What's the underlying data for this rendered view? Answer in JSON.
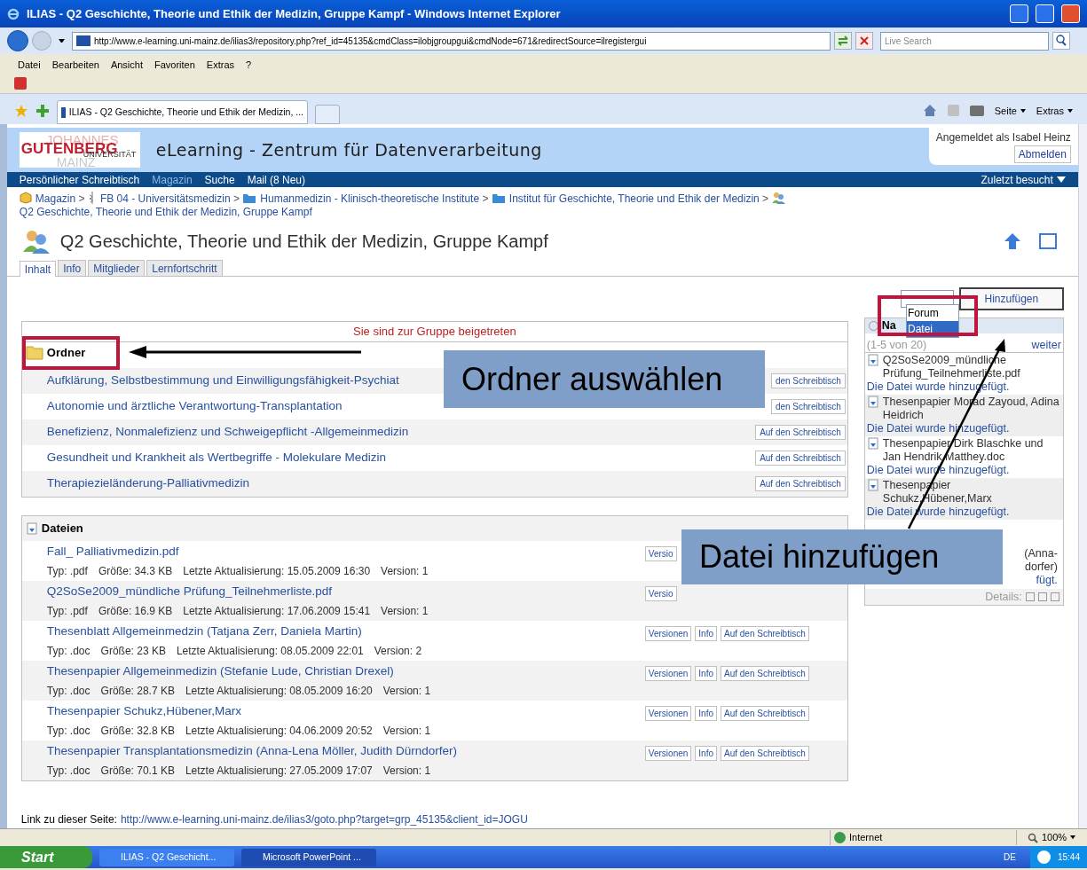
{
  "window": {
    "title": "ILIAS - Q2 Geschichte, Theorie und Ethik der Medizin, Gruppe Kampf - Windows Internet Explorer"
  },
  "address": {
    "url": "http://www.e-learning.uni-mainz.de/ilias3/repository.php?ref_id=45135&cmdClass=ilobjgroupgui&cmdNode=671&redirectSource=ilregistergui"
  },
  "search": {
    "placeholder": "Live Search"
  },
  "menu": [
    "Datei",
    "Bearbeiten",
    "Ansicht",
    "Favoriten",
    "Extras",
    "?"
  ],
  "browser_tab": {
    "title": "ILIAS - Q2 Geschichte, Theorie und Ethik der Medizin, ..."
  },
  "command_bar": [
    "Seite",
    "Extras"
  ],
  "site": {
    "logo": {
      "top": "JOHANNES",
      "main": "GUTENBERG",
      "sub": "UNIVERSITÄT",
      "bottom": "MAINZ"
    },
    "title": "eLearning - Zentrum für Datenverarbeitung",
    "login_text": "Angemeldet als Isabel Heinz",
    "logout": "Abmelden"
  },
  "nav": {
    "items": [
      {
        "label": "Persönlicher Schreibtisch",
        "selected": false
      },
      {
        "label": "Magazin",
        "selected": true
      },
      {
        "label": "Suche",
        "selected": false
      },
      {
        "label": "Mail (8 Neu)",
        "selected": false
      }
    ],
    "recent": "Zuletzt besucht"
  },
  "breadcrumb_separator": ">",
  "breadcrumb": [
    {
      "label": "Magazin",
      "kind": "box"
    },
    {
      "label": "FB 04 - Universitätsmedizin",
      "kind": "staff"
    },
    {
      "label": "Humanmedizin - Klinisch-theoretische Institute",
      "kind": "folder"
    },
    {
      "label": "Institut für Geschichte, Theorie und Ethik der Medizin",
      "kind": "folder"
    },
    {
      "label": "Q2 Geschichte, Theorie und Ethik der Medizin, Gruppe Kampf",
      "kind": "group"
    }
  ],
  "page_title": "Q2 Geschichte, Theorie und Ethik der Medizin, Gruppe Kampf",
  "tabs": [
    {
      "label": "Inhalt",
      "selected": true
    },
    {
      "label": "Info",
      "selected": false
    },
    {
      "label": "Mitglieder",
      "selected": false
    },
    {
      "label": "Lernfortschritt",
      "selected": false
    }
  ],
  "add_control": {
    "options": [
      {
        "label": "Forum",
        "selected": false
      },
      {
        "label": "Datei",
        "selected": true
      }
    ],
    "button": "Hinzufügen"
  },
  "message": "Sie sind zur Gruppe beigetreten",
  "folders": {
    "title": "Ordner",
    "rows": [
      {
        "name": "Aufklärung, Selbstbestimmung und Einwilligungsfähigkeit-Psychiat",
        "button": "den Schreibtisch"
      },
      {
        "name": "Autonomie und ärztliche Verantwortung-Transplantation",
        "button": "den Schreibtisch"
      },
      {
        "name": "Benefizienz, Nonmalefizienz und Schweigepflicht -Allgemeinmedizin",
        "button": "Auf den Schreibtisch"
      },
      {
        "name": "Gesundheit und Krankheit als Wertbegriffe - Molekulare Medizin",
        "button": "Auf den Schreibtisch"
      },
      {
        "name": "Therapiezieländerung-Palliativmedizin",
        "button": "Auf den Schreibtisch"
      }
    ]
  },
  "files": {
    "title": "Dateien",
    "rows": [
      {
        "name": "Fall_ Palliativmedizin.pdf",
        "meta": [
          "Typ: .pdf",
          "Größe: 34.3 KB",
          "Letzte Aktualisierung: 15.05.2009 16:30",
          "Version: 1"
        ],
        "buttons": [
          "Versio"
        ]
      },
      {
        "name": "Q2SoSe2009_mündliche Prüfung_Teilnehmerliste.pdf",
        "meta": [
          "Typ: .pdf",
          "Größe: 16.9 KB",
          "Letzte Aktualisierung: 17.06.2009 15:41",
          "Version: 1"
        ],
        "buttons": [
          "Versio"
        ]
      },
      {
        "name": "Thesenblatt Allgemeinmedzin (Tatjana Zerr, Daniela Martin)",
        "meta": [
          "Typ: .doc",
          "Größe: 23 KB",
          "Letzte Aktualisierung: 08.05.2009 22:01",
          "Version: 2"
        ],
        "buttons": [
          "Versionen",
          "Info",
          "Auf den Schreibtisch"
        ]
      },
      {
        "name": "Thesenpapier Allgemeinmedizin (Stefanie Lude, Christian Drexel)",
        "meta": [
          "Typ: .doc",
          "Größe: 28.7 KB",
          "Letzte Aktualisierung: 08.05.2009 16:20",
          "Version: 1"
        ],
        "buttons": [
          "Versionen",
          "Info",
          "Auf den Schreibtisch"
        ]
      },
      {
        "name": "Thesenpapier Schukz,Hübener,Marx",
        "meta": [
          "Typ: .doc",
          "Größe: 32.8 KB",
          "Letzte Aktualisierung: 04.06.2009 20:52",
          "Version: 1"
        ],
        "buttons": [
          "Versionen",
          "Info",
          "Auf den Schreibtisch"
        ]
      },
      {
        "name": "Thesenpapier Transplantationsmedizin (Anna-Lena Möller, Judith Dürndorfer)",
        "meta": [
          "Typ: .doc",
          "Größe: 70.1 KB",
          "Letzte Aktualisierung: 27.05.2009 17:07",
          "Version: 1"
        ],
        "buttons": [
          "Versionen",
          "Info",
          "Auf den Schreibtisch"
        ]
      }
    ]
  },
  "news": {
    "title": "Na",
    "range": "(1-5 von 20)",
    "more": "weiter",
    "items": [
      {
        "title": "Q2SoSe2009_mündliche Prüfung_Teilnehmerliste.pdf",
        "note": "Die Datei wurde hinzugefügt."
      },
      {
        "title": "Thesenpapier Morad Zayoud, Adina Heidrich",
        "note": "Die Datei wurde hinzugefügt."
      },
      {
        "title": "Thesenpapier Dirk Blaschke und Jan Hendrik Matthey.doc",
        "note": "Die Datei wurde hinzugefügt."
      },
      {
        "title": "Thesenpapier Schukz,Hübener,Marx",
        "note": "Die Datei wurde hinzugefügt."
      }
    ],
    "partial": [
      "(Anna-",
      "dorfer)",
      "fügt."
    ],
    "details": "Details:"
  },
  "link_line": {
    "label": "Link zu dieser Seite:",
    "url": "http://www.e-learning.uni-mainz.de/ilias3/goto.php?target=grp_45135&client_id=JOGU"
  },
  "status": {
    "zone": "Internet",
    "zoom": "100%"
  },
  "taskbar": {
    "start": "Start",
    "tasks": [
      "ILIAS - Q2 Geschicht...",
      "Microsoft PowerPoint ..."
    ],
    "language": "DE",
    "clock": "15:44"
  },
  "annotations": [
    {
      "text": "Ordner auswählen"
    },
    {
      "text": "Datei hinzufügen"
    }
  ]
}
